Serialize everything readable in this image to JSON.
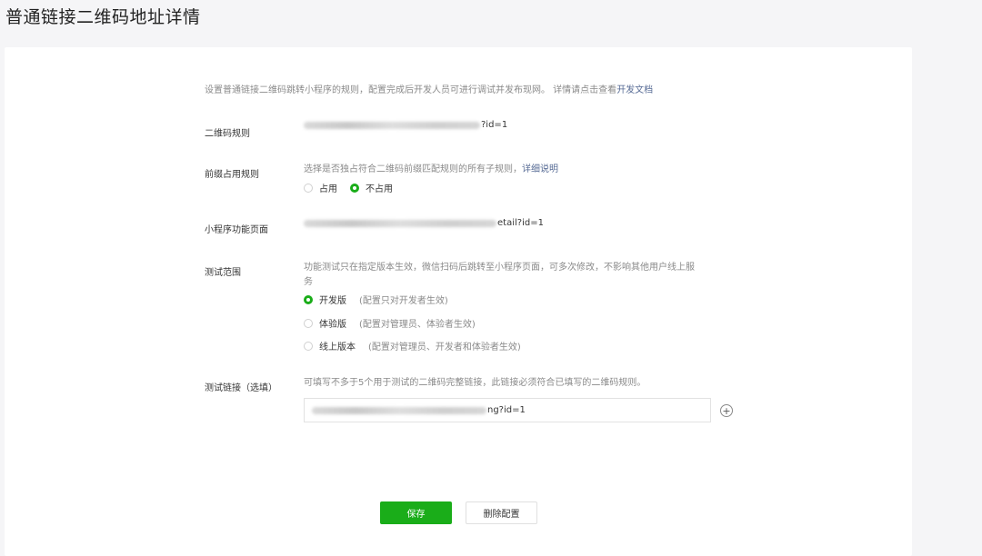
{
  "page": {
    "title": "普通链接二维码地址详情"
  },
  "intro": {
    "text": "设置普通链接二维码跳转小程序的规则，配置完成后开发人员可进行调试并发布现网。 详情请点击查看",
    "link": "开发文档"
  },
  "qr_rule": {
    "label": "二维码规则",
    "value_suffix": "?id=1"
  },
  "prefix_rule": {
    "label": "前缀占用规则",
    "hint": "选择是否独占符合二维码前缀匹配规则的所有子规则，",
    "hint_link": "详细说明",
    "options": [
      {
        "label": "占用",
        "selected": false
      },
      {
        "label": "不占用",
        "selected": true
      }
    ]
  },
  "page_path": {
    "label": "小程序功能页面",
    "value_suffix": "etail?id=1"
  },
  "test_scope": {
    "label": "测试范围",
    "hint": "功能测试只在指定版本生效，微信扫码后跳转至小程序页面，可多次修改，不影响其他用户线上服务",
    "options": [
      {
        "label": "开发版",
        "note": "(配置只对开发者生效)",
        "selected": true
      },
      {
        "label": "体验版",
        "note": "(配置对管理员、体验者生效)",
        "selected": false
      },
      {
        "label": "线上版本",
        "note": "(配置对管理员、开发者和体验者生效)",
        "selected": false
      }
    ]
  },
  "test_link": {
    "label": "测试链接（选填）",
    "hint": "可填写不多于5个用于测试的二维码完整链接，此链接必须符合已填写的二维码规则。",
    "value_suffix": "ng?id=1",
    "add_symbol": "+"
  },
  "actions": {
    "save": "保存",
    "delete": "删除配置"
  },
  "colors": {
    "accent": "#1aad19",
    "link": "#576b95"
  }
}
